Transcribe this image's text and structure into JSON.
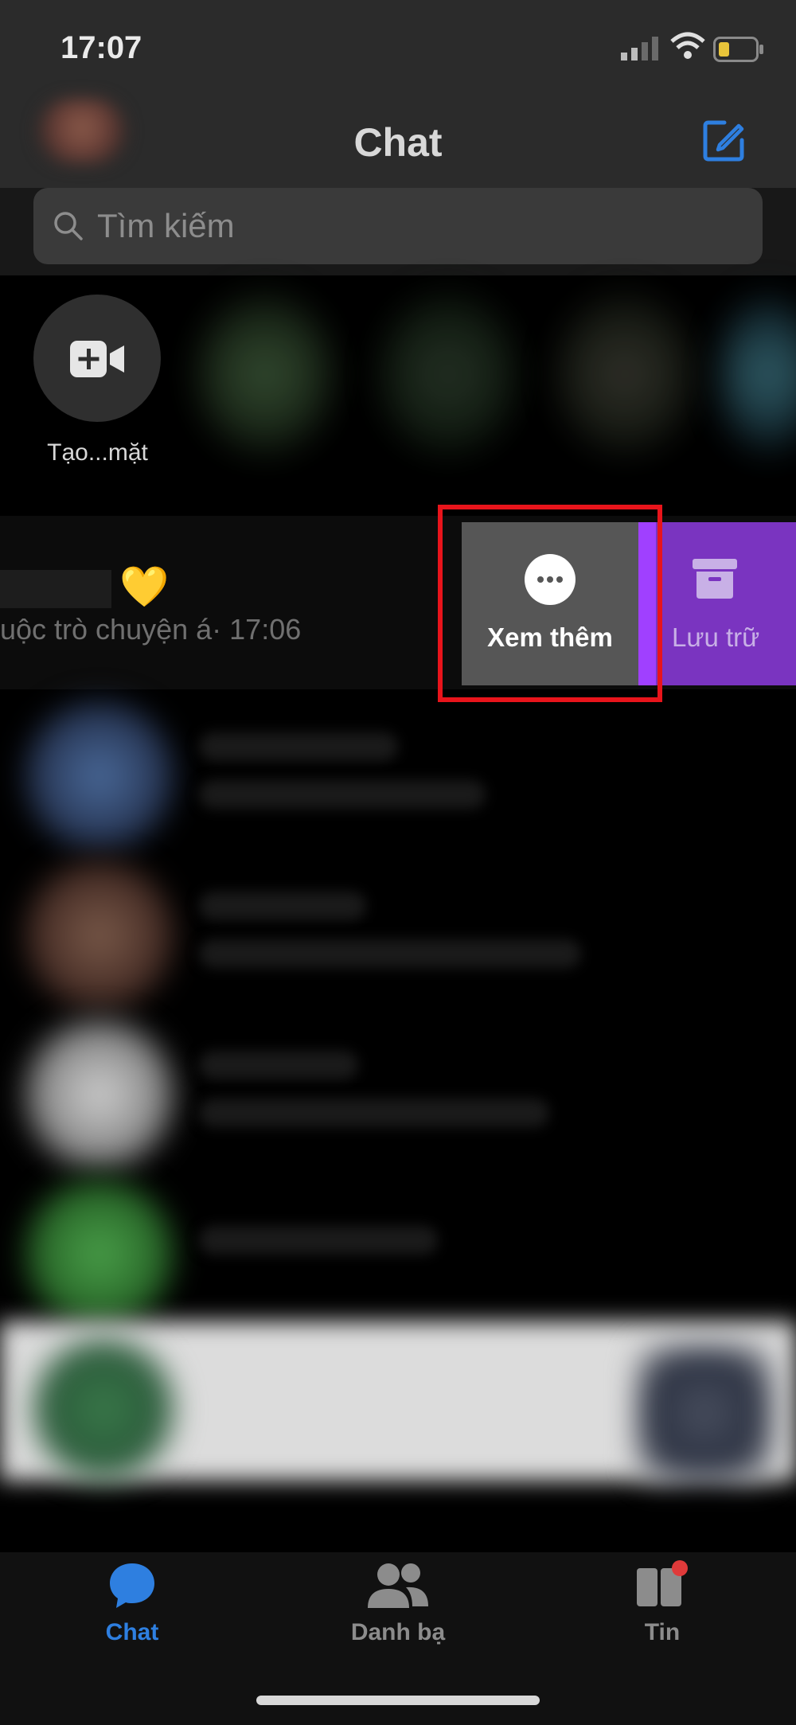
{
  "status_bar": {
    "time": "17:07"
  },
  "header": {
    "title": "Chat"
  },
  "search": {
    "placeholder": "Tìm kiếm"
  },
  "stories": {
    "video_label": "Tạo...mặt"
  },
  "chat_row": {
    "preview": "uộc trò chuyện á· 17:06",
    "emoji": "💛"
  },
  "swipe_actions": {
    "more_label": "Xem thêm",
    "archive_label": "Lưu trữ"
  },
  "tabbar": {
    "chat_label": "Chat",
    "contacts_label": "Danh bạ",
    "news_label": "Tin"
  },
  "colors": {
    "accent_blue": "#2e7fe0",
    "archive_purple": "#7a34c0",
    "highlight_red": "#e8141b"
  }
}
